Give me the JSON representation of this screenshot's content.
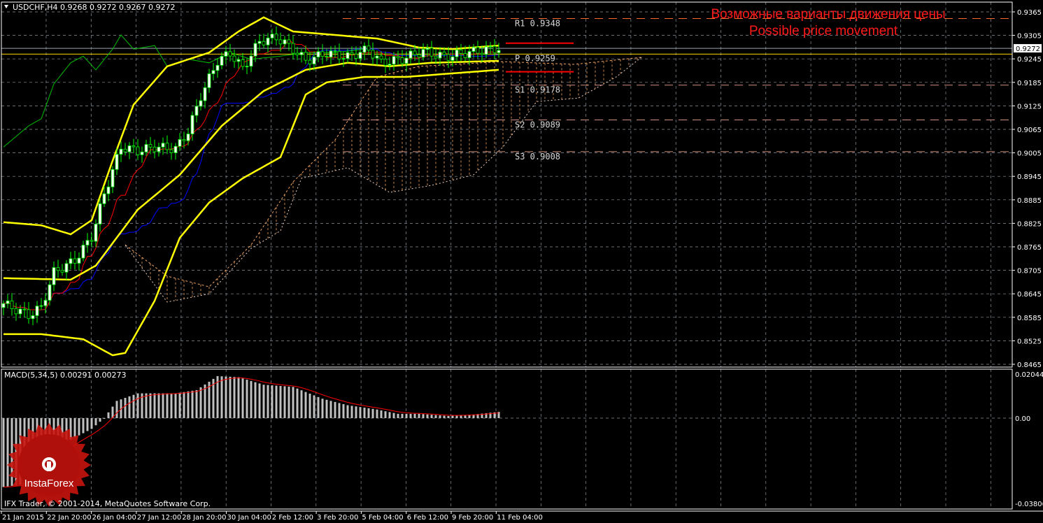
{
  "header": {
    "symbol_title": "USDCHF,H4  0.9268 0.9272 0.9267 0.9272",
    "macd_title": "MACD(5,34,5) 0.00291 0.00273",
    "copyright": "IFX Trader, © 2001-2014, MetaQuotes Software Corp.",
    "logo_text": "InstaForex"
  },
  "annotation": {
    "line1": "Возможные варианты движения цены",
    "line2": "Possible price movement"
  },
  "colors": {
    "background": "#000000",
    "grid": "#8c96a0",
    "candle": "#00ff00",
    "bollinger": "#ffff00",
    "tenkan": "#ff0000",
    "kijun": "#0000ff",
    "chikou": "#00c000",
    "cloud": "#f4a460",
    "pivot": "#ff6a2a",
    "support": "#d09080",
    "annotation": "#ff1a1a",
    "macd": "#c0c0c0",
    "signal": "#ff0000"
  },
  "chart_data": [
    {
      "type": "candlestick",
      "title": "USDCHF,H4",
      "ohlc_last": {
        "open": 0.9268,
        "high": 0.9272,
        "low": 0.9267,
        "close": 0.9272
      },
      "current_price": "0.9272",
      "ylim": [
        0.8465,
        0.9365
      ],
      "y_ticks": [
        "0.9365",
        "0.9305",
        "0.9245",
        "0.9185",
        "0.9125",
        "0.9065",
        "0.9005",
        "0.8945",
        "0.8885",
        "0.8825",
        "0.8765",
        "0.8705",
        "0.8645",
        "0.8585",
        "0.8525",
        "0.8465"
      ],
      "x_ticks": [
        "21 Jan 2015",
        "22 Jan 20:00",
        "26 Jan 04:00",
        "27 Jan 12:00",
        "28 Jan 20:00",
        "30 Jan 04:00",
        "2 Feb 12:00",
        "3 Feb 20:00",
        "5 Feb 04:00",
        "6 Feb 12:00",
        "9 Feb 20:00",
        "11 Feb 04:00"
      ],
      "bars": 119,
      "close_keypoints": [
        [
          0,
          0.862
        ],
        [
          6,
          0.859
        ],
        [
          9,
          0.861
        ],
        [
          12,
          0.87
        ],
        [
          17,
          0.873
        ],
        [
          21,
          0.879
        ],
        [
          24,
          0.89
        ],
        [
          28,
          0.902
        ],
        [
          32,
          0.901
        ],
        [
          36,
          0.902
        ],
        [
          41,
          0.9015
        ],
        [
          44,
          0.906
        ],
        [
          47,
          0.915
        ],
        [
          51,
          0.924
        ],
        [
          54,
          0.926
        ],
        [
          57,
          0.922
        ],
        [
          61,
          0.929
        ],
        [
          65,
          0.93
        ],
        [
          69,
          0.927
        ],
        [
          72,
          0.924
        ],
        [
          77,
          0.926
        ],
        [
          82,
          0.925
        ],
        [
          87,
          0.927
        ],
        [
          90,
          0.9235
        ],
        [
          95,
          0.9245
        ],
        [
          100,
          0.9265
        ],
        [
          105,
          0.925
        ],
        [
          110,
          0.926
        ],
        [
          115,
          0.9268
        ],
        [
          118,
          0.9272
        ]
      ],
      "bollinger_upper": [
        [
          0,
          0.8828
        ],
        [
          9,
          0.882
        ],
        [
          16,
          0.8797
        ],
        [
          21,
          0.8833
        ],
        [
          26,
          0.8985
        ],
        [
          31,
          0.9128
        ],
        [
          39,
          0.9226
        ],
        [
          49,
          0.9261
        ],
        [
          56,
          0.9315
        ],
        [
          62,
          0.9351
        ],
        [
          69,
          0.9315
        ],
        [
          79,
          0.9306
        ],
        [
          89,
          0.9297
        ],
        [
          99,
          0.9274
        ],
        [
          107,
          0.927
        ],
        [
          118,
          0.9279
        ]
      ],
      "bollinger_middle": [
        [
          0,
          0.8685
        ],
        [
          16,
          0.8681
        ],
        [
          22,
          0.8717
        ],
        [
          32,
          0.886
        ],
        [
          42,
          0.8949
        ],
        [
          52,
          0.9074
        ],
        [
          62,
          0.9163
        ],
        [
          72,
          0.9217
        ],
        [
          82,
          0.9235
        ],
        [
          92,
          0.9226
        ],
        [
          102,
          0.9235
        ],
        [
          118,
          0.924
        ]
      ],
      "bollinger_lower": [
        [
          0,
          0.8542
        ],
        [
          9,
          0.8542
        ],
        [
          19,
          0.8529
        ],
        [
          26,
          0.8488
        ],
        [
          29,
          0.8494
        ],
        [
          36,
          0.8627
        ],
        [
          42,
          0.8788
        ],
        [
          49,
          0.8878
        ],
        [
          57,
          0.894
        ],
        [
          66,
          0.8994
        ],
        [
          72,
          0.9154
        ],
        [
          77,
          0.9185
        ],
        [
          86,
          0.9199
        ],
        [
          96,
          0.9199
        ],
        [
          118,
          0.9217
        ]
      ],
      "chikou": [
        [
          0,
          0.902
        ],
        [
          2,
          0.9038
        ],
        [
          6,
          0.9074
        ],
        [
          9,
          0.9092
        ],
        [
          12,
          0.9181
        ],
        [
          16,
          0.9235
        ],
        [
          19,
          0.9252
        ],
        [
          22,
          0.9217
        ],
        [
          26,
          0.927
        ],
        [
          28,
          0.9306
        ],
        [
          31,
          0.927
        ],
        [
          36,
          0.9279
        ],
        [
          39,
          0.9226
        ],
        [
          44,
          0.9244
        ],
        [
          49,
          0.9235
        ],
        [
          54,
          0.9261
        ],
        [
          59,
          0.9244
        ],
        [
          66,
          0.9252
        ],
        [
          72,
          0.9261
        ],
        [
          79,
          0.9261
        ],
        [
          86,
          0.927
        ]
      ],
      "cloud_upper": [
        [
          29,
          0.877
        ],
        [
          39,
          0.869
        ],
        [
          49,
          0.8663
        ],
        [
          59,
          0.877
        ],
        [
          69,
          0.8931
        ],
        [
          79,
          0.9038
        ],
        [
          89,
          0.9199
        ],
        [
          99,
          0.9226
        ],
        [
          119,
          0.9238
        ],
        [
          136,
          0.9231
        ],
        [
          152,
          0.9249
        ]
      ],
      "cloud_lower": [
        [
          29,
          0.877
        ],
        [
          39,
          0.8624
        ],
        [
          49,
          0.8645
        ],
        [
          59,
          0.8761
        ],
        [
          66,
          0.8806
        ],
        [
          71,
          0.894
        ],
        [
          82,
          0.8967
        ],
        [
          92,
          0.8904
        ],
        [
          102,
          0.8922
        ],
        [
          112,
          0.8949
        ],
        [
          119,
          0.902
        ],
        [
          127,
          0.9136
        ],
        [
          137,
          0.9145
        ],
        [
          146,
          0.9199
        ],
        [
          152,
          0.9249
        ]
      ],
      "pivots": [
        {
          "label": "R1",
          "value": "0.9348"
        },
        {
          "label": "P",
          "value": "0.9259"
        },
        {
          "label": "S1",
          "value": "0.9178"
        },
        {
          "label": "S2",
          "value": "0.9089"
        },
        {
          "label": "S3",
          "value": "0.9008"
        }
      ],
      "target_lines": [
        0.9285,
        0.9212
      ]
    },
    {
      "type": "bar",
      "title": "MACD(5,34,5)",
      "ylim": [
        -0.03806,
        0.02044
      ],
      "y_ticks": [
        "0.02044",
        "0.00",
        "-0.03806"
      ],
      "histogram_keypoints": [
        [
          0,
          -0.032
        ],
        [
          7,
          -0.03
        ],
        [
          9,
          -0.02
        ],
        [
          16,
          -0.01
        ],
        [
          21,
          -0.005
        ],
        [
          24,
          0.0
        ],
        [
          27,
          0.008
        ],
        [
          32,
          0.0115
        ],
        [
          41,
          0.0115
        ],
        [
          46,
          0.013
        ],
        [
          51,
          0.0195
        ],
        [
          56,
          0.019
        ],
        [
          62,
          0.0155
        ],
        [
          69,
          0.0145
        ],
        [
          76,
          0.009
        ],
        [
          82,
          0.006
        ],
        [
          89,
          0.004
        ],
        [
          94,
          0.002
        ],
        [
          99,
          0.002
        ],
        [
          106,
          0.001
        ],
        [
          112,
          0.0017
        ],
        [
          118,
          0.0029
        ]
      ],
      "macd": 0.00291,
      "signal": 0.00273
    }
  ]
}
